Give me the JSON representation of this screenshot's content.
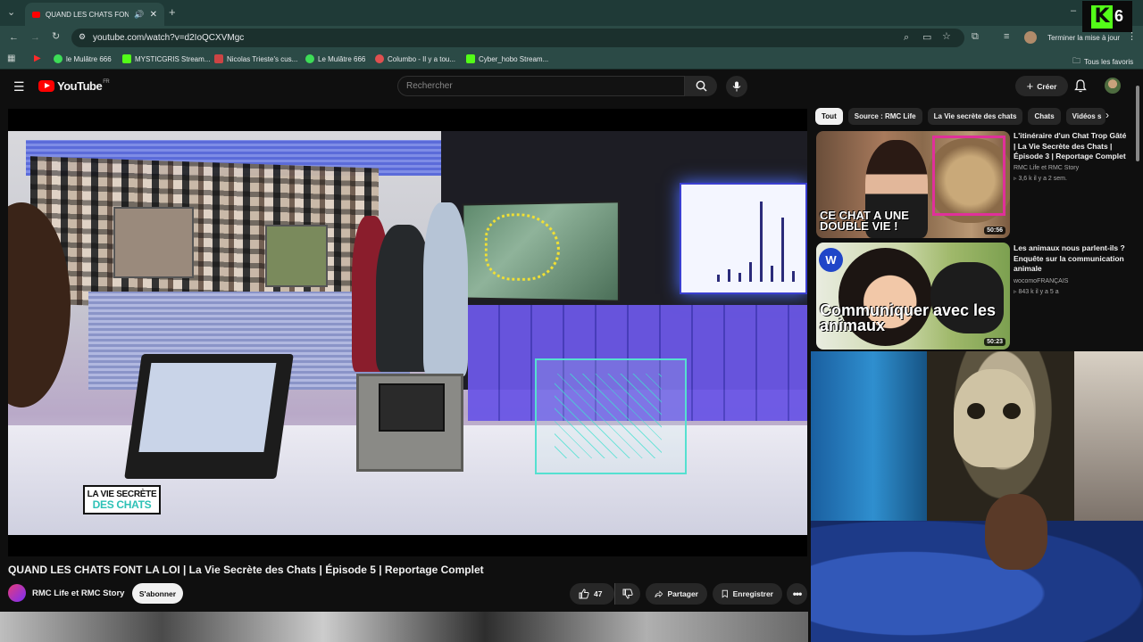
{
  "browser": {
    "tab_title": "QUAND LES CHATS FONT |",
    "url": "youtube.com/watch?v=d2IoQCXVMgc",
    "update_button": "Terminer la mise à jour",
    "bookmarks": [
      {
        "label": "le Mulâtre 666",
        "color": "#3ddc57"
      },
      {
        "label": "MYSTICGRIS Stream...",
        "color": "#53fc18"
      },
      {
        "label": "Nicolas Trieste's cus...",
        "color": "#c44"
      },
      {
        "label": "Le Mulâtre 666",
        "color": "#3ddc57"
      },
      {
        "label": "Columbo - Il y a tou...",
        "color": "#e05050"
      },
      {
        "label": "Cyber_hobo Stream...",
        "color": "#53fc18"
      }
    ],
    "all_bookmarks": "Tous les favoris"
  },
  "youtube": {
    "logo_text": "YouTube",
    "logo_region": "FR",
    "search_placeholder": "Rechercher",
    "create_label": "Créer"
  },
  "video": {
    "overlay_badge_line1": "LA VIE SECRÈTE",
    "overlay_badge_line2": "DES CHATS",
    "title": "QUAND LES CHATS FONT LA LOI | La Vie Secrète des Chats | Épisode 5 | Reportage Complet",
    "channel": "RMC Life et RMC Story",
    "subscribe_label": "S'abonner",
    "likes": "47",
    "share_label": "Partager",
    "save_label": "Enregistrer"
  },
  "sidebar": {
    "chips": [
      "Tout",
      "Source : RMC Life",
      "La Vie secrète des chats",
      "Chats",
      "Vidéos s"
    ],
    "recommendations": [
      {
        "title": "L'itinéraire d'un Chat Trop Gâté | La Vie Secrète des Chats | Épisode 3 | Reportage Complet",
        "channel": "RMC Life et RMC Story",
        "meta": "3,6 k  il y a 2 sem.",
        "duration": "50:56",
        "thumb_text": "CE CHAT A UNE DOUBLE VIE !"
      },
      {
        "title": "Les animaux nous parlent-ils ? Enquête sur la communication animale",
        "channel": "wocomoFRANÇAIS",
        "meta": "843 k  il y a 5 a",
        "duration": "50:23",
        "thumb_text": "Communiquer avec les animaux",
        "thumb_logo": "W"
      }
    ]
  },
  "overlay": {
    "k_letter": "K",
    "number": "6"
  }
}
